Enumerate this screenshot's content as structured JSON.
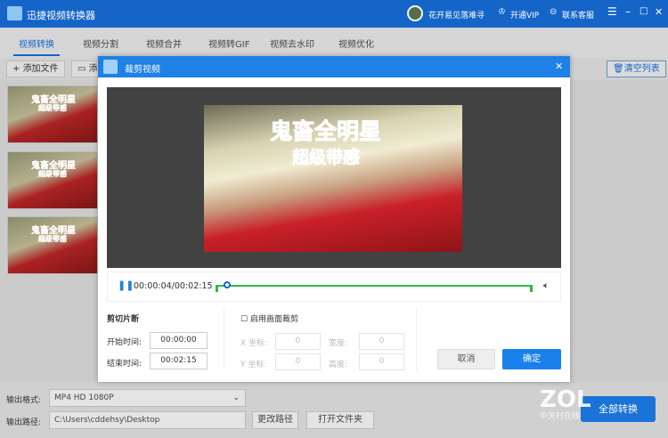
{
  "app": {
    "title": "迅捷视频转换器",
    "user": "花开易见落难寻",
    "vip": "开通VIP",
    "service": "联系客服"
  },
  "tabs": [
    {
      "label": "视频转换"
    },
    {
      "label": "视频分割"
    },
    {
      "label": "视频合并"
    },
    {
      "label": "视频转GIF"
    },
    {
      "label": "视频去水印"
    },
    {
      "label": "视频优化"
    }
  ],
  "toolbar": {
    "add_file": "添加文件",
    "add_folder": "添",
    "clear": "清空列表"
  },
  "thumbs": {
    "title": "鬼畜全明星",
    "subtitle": "超级带感"
  },
  "dialog": {
    "title": "裁剪视频",
    "video_title": "鬼畜全明星",
    "video_subtitle": "超级带感",
    "time": "00:00:04/00:02:15",
    "progress": 0.03,
    "section": "剪切片断",
    "start_label": "开始时间:",
    "start": "00:00:00",
    "end_label": "结束时间:",
    "end": "00:02:15",
    "crop_label": "启用画面裁剪",
    "x_label": "X 坐标:",
    "x": "0",
    "y_label": "Y 坐标:",
    "y": "0",
    "w_label": "宽度:",
    "w": "0",
    "h_label": "高度:",
    "h": "0",
    "cancel": "取消",
    "ok": "确定"
  },
  "bottom": {
    "format_label": "输出格式:",
    "format": "MP4  HD 1080P",
    "path_label": "输出路径:",
    "path": "C:\\Users\\cddehsy\\Desktop",
    "change_path": "更改路径",
    "open_folder": "打开文件夹",
    "convert_all": "全部转换",
    "watermark": "ZOL",
    "watermark_sub": "中关村在线"
  }
}
